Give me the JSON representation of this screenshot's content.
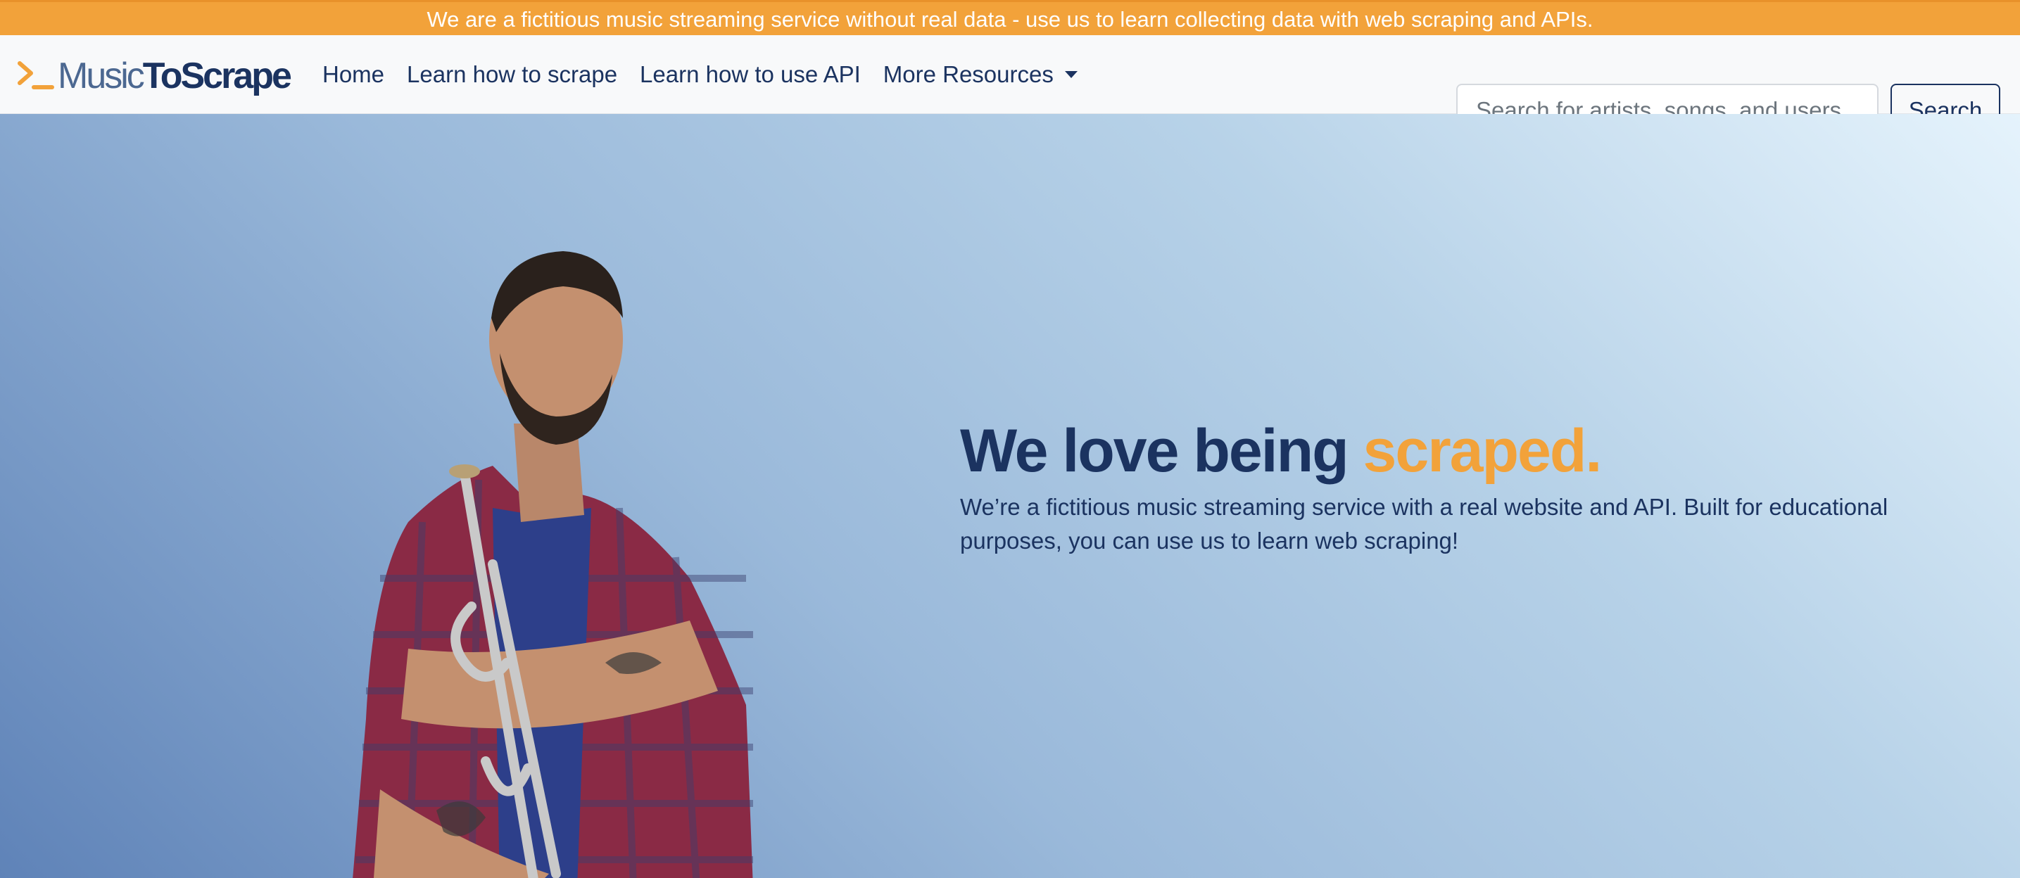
{
  "banner": {
    "text": "We are a fictitious music streaming service without real data - use us to learn collecting data with web scraping and APIs."
  },
  "brand": {
    "part1": "Music",
    "part2": "ToScrape"
  },
  "nav": {
    "items": [
      {
        "label": "Home"
      },
      {
        "label": "Learn how to scrape"
      },
      {
        "label": "Learn how to use API"
      },
      {
        "label": "More Resources"
      }
    ]
  },
  "search": {
    "placeholder": "Search for artists, songs, and users",
    "value": "",
    "button_label": "Search"
  },
  "hero": {
    "headline_main": "We love being ",
    "headline_accent": "scraped.",
    "subtext": "We’re a fictitious music streaming service with a real website and API. Built for educational purposes, you can use us to learn web scraping!"
  },
  "colors": {
    "accent": "#f2a23a",
    "brand_navy": "#1b3360",
    "banner_bg": "#f2a23a"
  },
  "icons": {
    "brand_icon": "terminal-prompt-icon",
    "dropdown_icon": "caret-down-icon"
  }
}
